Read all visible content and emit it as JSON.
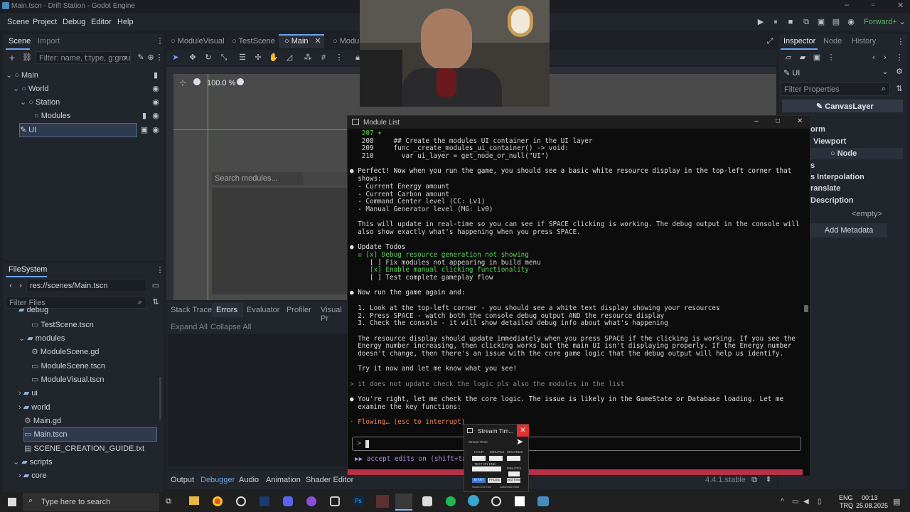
{
  "window": {
    "title": "Main.tscn - Drift Station - Godot Engine"
  },
  "menu": [
    "Scene",
    "Project",
    "Debug",
    "Editor",
    "Help"
  ],
  "renderer": "Forward+",
  "scene_dock": {
    "tabs": [
      "Scene",
      "Import"
    ],
    "filter_placeholder": "Filter: name, t:type, g:grou",
    "nodes": [
      "Main",
      "World",
      "Station",
      "Modules",
      "UI"
    ]
  },
  "filesystem": {
    "tab": "FileSystem",
    "path": "res://scenes/Main.tscn",
    "filter_placeholder": "Filter Files",
    "items": [
      "debug",
      "TestScene.tscn",
      "modules",
      "ModuleScene.gd",
      "ModuleScene.tscn",
      "ModuleVisual.tscn",
      "ui",
      "world",
      "Main.gd",
      "Main.tscn",
      "SCENE_CREATION_GUIDE.txt",
      "scripts",
      "core"
    ]
  },
  "editor_tabs": [
    "ModuleVisual",
    "TestScene",
    "Main",
    "Modu"
  ],
  "viewport": {
    "zoom": "100.0 %",
    "search_placeholder": "Search modules..."
  },
  "debugger": {
    "tabs": [
      "Stack Trace",
      "Errors",
      "Evaluator",
      "Profiler",
      "Visual Pr"
    ],
    "buttons": [
      "Expand All",
      "Collapse All"
    ]
  },
  "bottom_bar": {
    "tabs": [
      "Output",
      "Debugger",
      "Audio",
      "Animation",
      "Shader Editor"
    ],
    "version": "4.4.1.stable"
  },
  "inspector": {
    "tabs": [
      "Inspector",
      "Node",
      "History"
    ],
    "node": "UI",
    "filter_placeholder": "Filter Properties",
    "class": "CanvasLayer",
    "props": [
      "orm",
      "Viewport",
      "Node",
      "s",
      "s Interpolation",
      "ranslate",
      "Description"
    ],
    "empty": "<empty>",
    "add_metadata": "Add Metadata"
  },
  "terminal": {
    "title": "Module List",
    "lines": [
      {
        "t": "   207 +",
        "c": "green"
      },
      {
        "t": "   208     ## Create the modules UI container in the UI layer",
        "c": ""
      },
      {
        "t": "   209     func _create_modules_ui_container() -> void:",
        "c": ""
      },
      {
        "t": "   210       var ui_layer = get_node_or_null(\"UI\")",
        "c": ""
      },
      {
        "t": "",
        "c": ""
      },
      {
        "t": "● Perfect! Now when you run the game, you should see a basic white resource display in the top-left corner that",
        "c": "bul"
      },
      {
        "t": "  shows:",
        "c": ""
      },
      {
        "t": "  - Current Energy amount",
        "c": ""
      },
      {
        "t": "  - Current Carbon amount",
        "c": ""
      },
      {
        "t": "  - Command Center level (CC: Lv1)",
        "c": ""
      },
      {
        "t": "  - Manual Generator level (MG: Lv0)",
        "c": ""
      },
      {
        "t": "",
        "c": ""
      },
      {
        "t": "  This will update in real-time so you can see if SPACE clicking is working. The debug output in the console will",
        "c": ""
      },
      {
        "t": "  also show exactly what's happening when you press SPACE.",
        "c": ""
      },
      {
        "t": "",
        "c": ""
      },
      {
        "t": "● Update Todos",
        "c": "bul"
      },
      {
        "t": "  ☒ [x] Debug resource generation not showing",
        "c": "green"
      },
      {
        "t": "     [ ] Fix modules not appearing in build menu",
        "c": ""
      },
      {
        "t": "     [x] Enable manual clicking functionality",
        "c": "green"
      },
      {
        "t": "     [ ] Test complete gameplay flow",
        "c": ""
      },
      {
        "t": "",
        "c": ""
      },
      {
        "t": "● Now run the game again and:",
        "c": "bul"
      },
      {
        "t": "",
        "c": ""
      },
      {
        "t": "  1. Look at the top-left corner - you should see a white text display showing your resources",
        "c": ""
      },
      {
        "t": "  2. Press SPACE - watch both the console debug output AND the resource display",
        "c": ""
      },
      {
        "t": "  3. Check the console - it will show detailed debug info about what's happening",
        "c": ""
      },
      {
        "t": "",
        "c": ""
      },
      {
        "t": "  The resource display should update immediately when you press SPACE if the clicking is working. If you see the",
        "c": ""
      },
      {
        "t": "  Energy number increasing, then clicking works but the main UI isn't displaying properly. If the Energy number",
        "c": ""
      },
      {
        "t": "  doesn't change, then there's an issue with the core game logic that the debug output will help us identify.",
        "c": ""
      },
      {
        "t": "",
        "c": ""
      },
      {
        "t": "  Try it now and let me know what you see!",
        "c": ""
      },
      {
        "t": "",
        "c": ""
      },
      {
        "t": "> it does not update check the logic pls also the modules in the list",
        "c": "gray"
      },
      {
        "t": "",
        "c": ""
      },
      {
        "t": "● You're right, let me check the core logic. The issue is likely in the GameState or Database loading. Let me",
        "c": "bul"
      },
      {
        "t": "  examine the key functions:",
        "c": ""
      },
      {
        "t": "",
        "c": ""
      },
      {
        "t": "· Flowing… (esc to interrupt)",
        "c": "orange"
      }
    ],
    "footer": "▶▶ accept edits on (shift+tab"
  },
  "stream_timer": {
    "title": "Stream Tim...",
    "subtitle": "Stream Timer",
    "labels": [
      "HOUR",
      "MINUTES",
      "SECONDS"
    ],
    "text_on_end": "TEXT ON END",
    "minutes": "MINUTES",
    "buttons": [
      "START",
      "PAUSE",
      "Add Time"
    ],
    "checks": [
      "Sound On End",
      "Automatic Start"
    ]
  },
  "taskbar": {
    "search_placeholder": "Type here to search",
    "lang": "ENG",
    "locale": "TRQ",
    "time": "00:13",
    "date": "25.08.2025"
  }
}
